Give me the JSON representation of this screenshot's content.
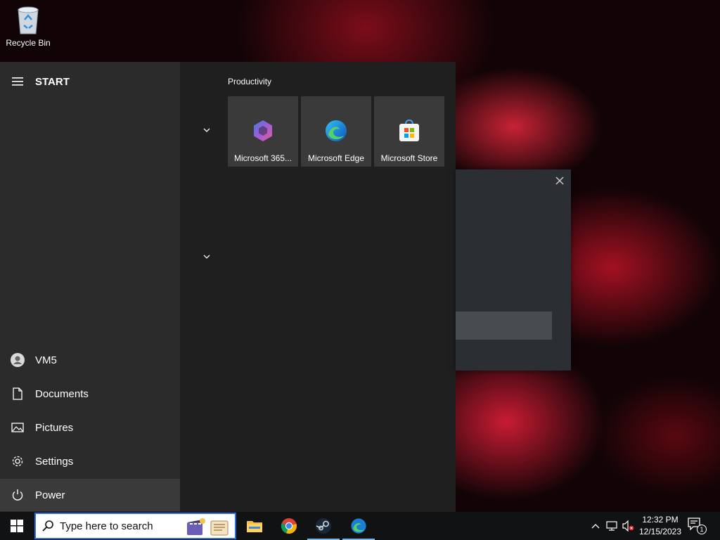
{
  "desktop": {
    "icons": [
      {
        "label": "Recycle Bin",
        "icon": "recycle-bin-icon"
      }
    ]
  },
  "start_menu": {
    "header": {
      "label": "START",
      "icon": "hamburger-menu-icon"
    },
    "rail_items": [
      {
        "label": "VM5",
        "icon": "user-avatar-icon"
      },
      {
        "label": "Documents",
        "icon": "document-icon"
      },
      {
        "label": "Pictures",
        "icon": "pictures-icon"
      },
      {
        "label": "Settings",
        "icon": "gear-icon"
      },
      {
        "label": "Power",
        "icon": "power-icon"
      }
    ],
    "group": {
      "title": "Productivity",
      "tiles": [
        {
          "label": "Microsoft 365...",
          "icon": "microsoft-365-icon"
        },
        {
          "label": "Microsoft Edge",
          "icon": "edge-icon"
        },
        {
          "label": "Microsoft Store",
          "icon": "store-icon"
        }
      ]
    }
  },
  "taskbar": {
    "search_placeholder": "Type here to search",
    "pinned_apps": [
      {
        "name": "File Explorer",
        "icon": "file-explorer-icon"
      },
      {
        "name": "Google Chrome",
        "icon": "chrome-icon"
      },
      {
        "name": "Steam",
        "icon": "steam-icon"
      },
      {
        "name": "Microsoft Edge",
        "icon": "edge-icon"
      }
    ],
    "clock": {
      "time": "12:32 PM",
      "date": "12/15/2023"
    },
    "notification_count": "1"
  },
  "colors": {
    "accent": "#2b6cd8",
    "taskbar_bg": "#111214",
    "start_bg": "#1f1f1f",
    "rail_bg": "#2b2b2b",
    "tile_bg": "#3a3a3a"
  }
}
